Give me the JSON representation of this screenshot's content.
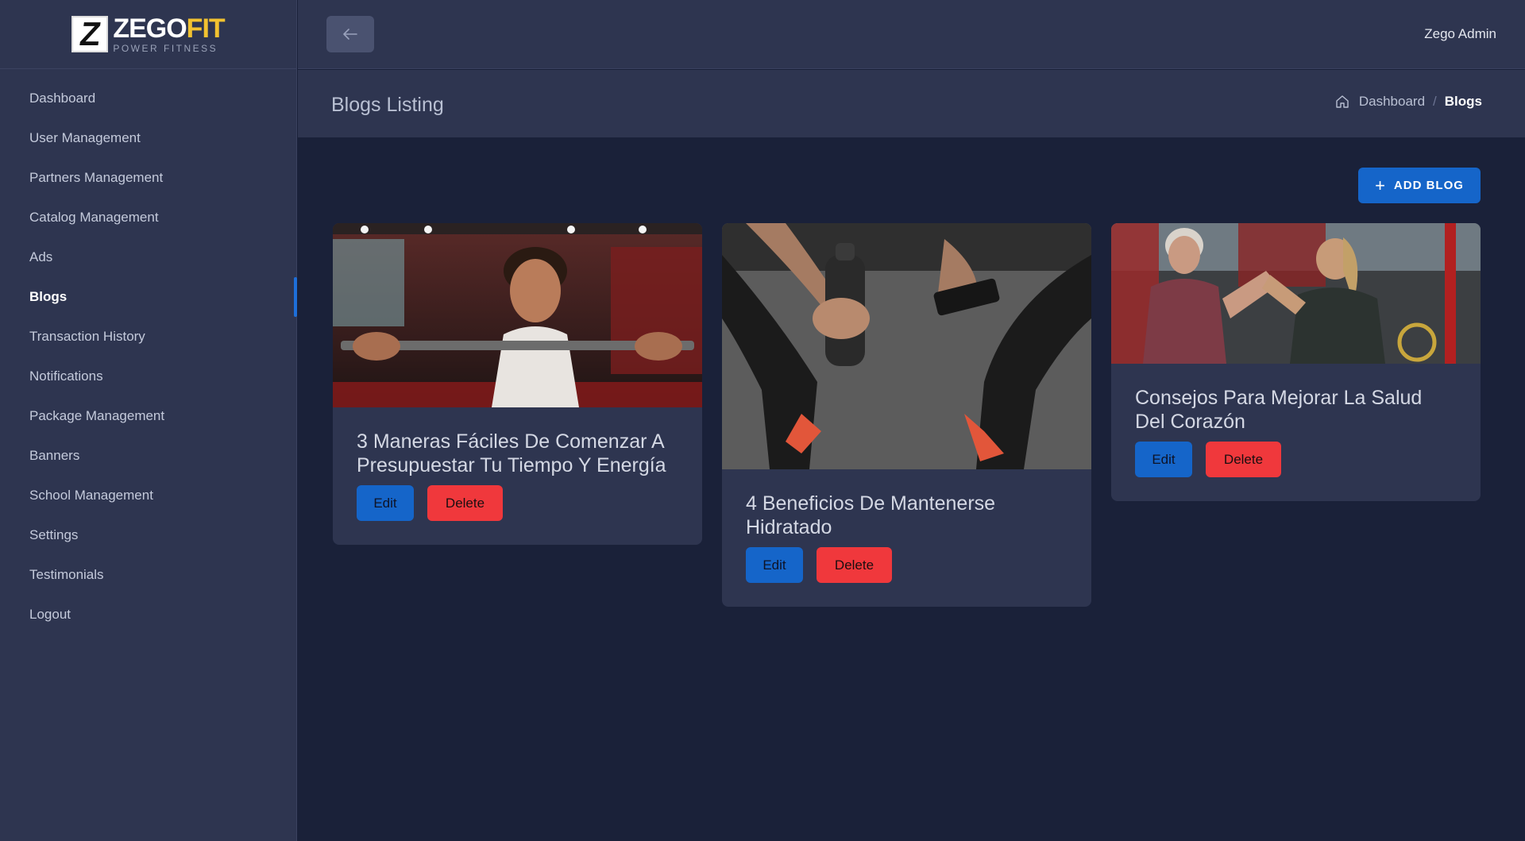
{
  "brand": {
    "mark": "Z",
    "name_part1": "ZEGO",
    "name_part2": "FIT",
    "tagline": "POWER FITNESS"
  },
  "sidebar": {
    "items": [
      {
        "label": "Dashboard"
      },
      {
        "label": "User Management"
      },
      {
        "label": "Partners Management"
      },
      {
        "label": "Catalog Management"
      },
      {
        "label": "Ads"
      },
      {
        "label": "Blogs",
        "active": true
      },
      {
        "label": "Transaction History"
      },
      {
        "label": "Notifications"
      },
      {
        "label": "Package Management"
      },
      {
        "label": "Banners"
      },
      {
        "label": "School Management"
      },
      {
        "label": "Settings"
      },
      {
        "label": "Testimonials"
      },
      {
        "label": "Logout"
      }
    ]
  },
  "header": {
    "back_icon": "arrow-left-icon",
    "user_name": "Zego Admin"
  },
  "page": {
    "title": "Blogs Listing",
    "breadcrumb": {
      "home_icon": "home-icon",
      "parent": "Dashboard",
      "separator": "/",
      "current": "Blogs"
    },
    "add_button": "ADD BLOG"
  },
  "blogs": [
    {
      "title": "3 Maneras Fáciles De Comenzar A Presupuestar Tu Tiempo Y Energía",
      "edit": "Edit",
      "delete": "Delete"
    },
    {
      "title": "4 Beneficios De Mantenerse Hidratado",
      "edit": "Edit",
      "delete": "Delete"
    },
    {
      "title": "Consejos Para Mejorar La Salud Del Corazón",
      "edit": "Edit",
      "delete": "Delete"
    }
  ],
  "colors": {
    "accent": "#1565c9",
    "danger": "#f0383c",
    "panel": "#2e3550",
    "background": "#1a2139",
    "brand_yellow": "#f2c230"
  }
}
